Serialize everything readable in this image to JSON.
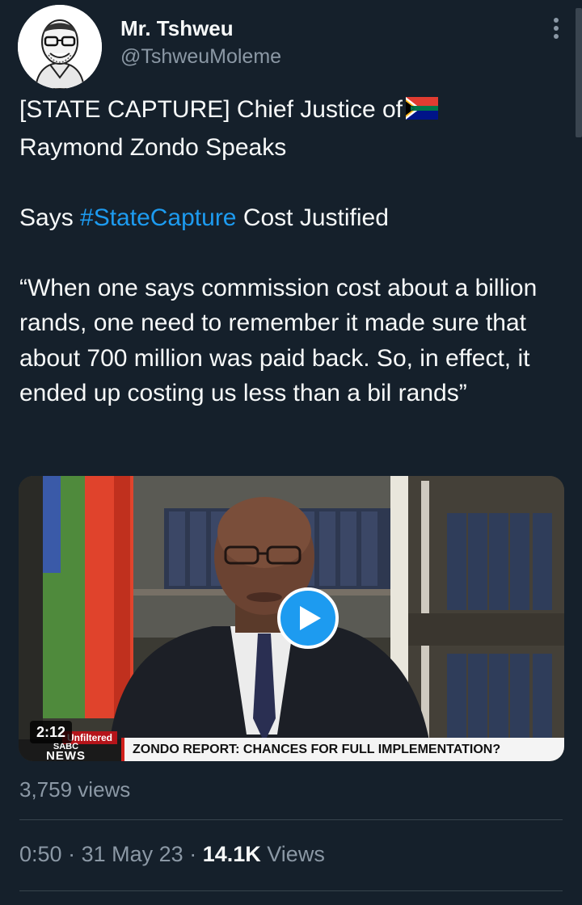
{
  "author": {
    "display_name": "Mr. Tshweu",
    "handle": "@TshweuMoleme"
  },
  "tweet": {
    "line1": "[STATE CAPTURE] Chief Justice of",
    "line2": "Raymond Zondo Speaks",
    "says_prefix": "Says ",
    "hashtag": "#StateCapture",
    "says_suffix": " Cost Justified",
    "quote": "“When one says commission cost about a billion rands, one need to remember it made sure that about 700 million was paid back. So, in effect, it ended up costing us less than a bil rands”",
    "flag_icon": "south-africa-flag-icon"
  },
  "media": {
    "duration": "2:12",
    "broadcaster_tag": "Unfiltered",
    "broadcaster_name": "SABC",
    "broadcaster_sub": "NEWS",
    "ticker": "ZONDO REPORT: CHANCES FOR FULL IMPLEMENTATION?"
  },
  "stats": {
    "video_views": "3,759 views",
    "time": "0:50",
    "date": "31 May 23",
    "view_count": "14.1K",
    "views_label": "Views"
  },
  "colors": {
    "background": "#15202b",
    "link": "#1d9bf0",
    "muted": "#8b98a5",
    "text": "#f7f9f9"
  }
}
